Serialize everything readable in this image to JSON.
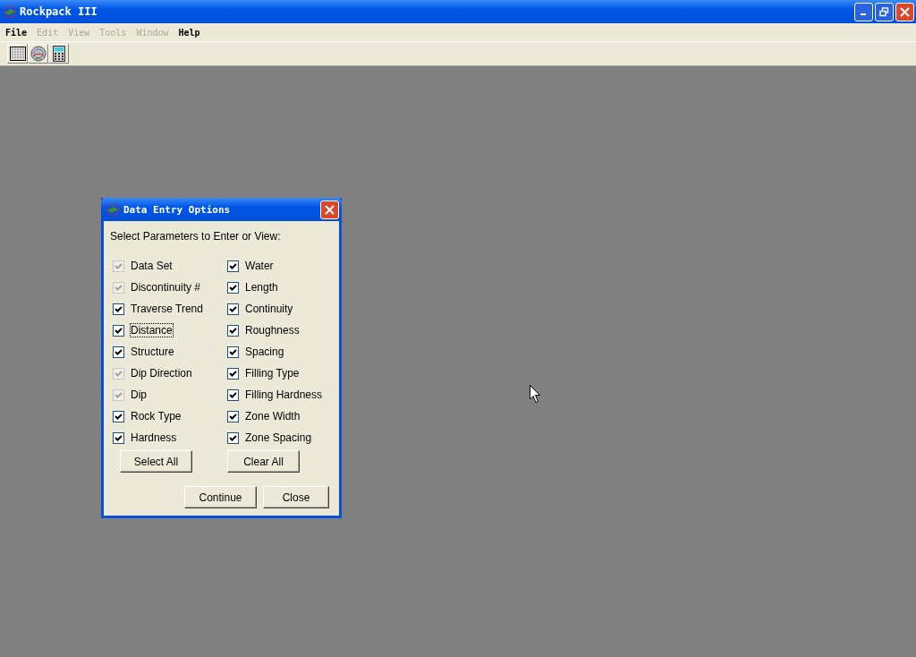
{
  "window": {
    "title": "Rockpack III"
  },
  "menu": [
    {
      "label": "File",
      "disabled": false
    },
    {
      "label": "Edit",
      "disabled": true
    },
    {
      "label": "View",
      "disabled": true
    },
    {
      "label": "Tools",
      "disabled": true
    },
    {
      "label": "Window",
      "disabled": true
    },
    {
      "label": "Help",
      "disabled": false
    }
  ],
  "toolbar": [
    {
      "kind": "grid"
    },
    {
      "kind": "stereonet"
    },
    {
      "kind": "calculator"
    }
  ],
  "dialog": {
    "title": "Data Entry Options",
    "prompt": "Select Parameters to Enter or View:",
    "parameters": [
      {
        "label": "Data Set",
        "checked": true,
        "disabled": true,
        "focused": false
      },
      {
        "label": "Discontinuity #",
        "checked": true,
        "disabled": true,
        "focused": false
      },
      {
        "label": "Traverse Trend",
        "checked": true,
        "disabled": false,
        "focused": false
      },
      {
        "label": "Distance",
        "checked": true,
        "disabled": false,
        "focused": true
      },
      {
        "label": "Structure",
        "checked": true,
        "disabled": false,
        "focused": false
      },
      {
        "label": "Dip Direction",
        "checked": true,
        "disabled": true,
        "focused": false
      },
      {
        "label": "Dip",
        "checked": true,
        "disabled": true,
        "focused": false
      },
      {
        "label": "Rock Type",
        "checked": true,
        "disabled": false,
        "focused": false
      },
      {
        "label": "Hardness",
        "checked": true,
        "disabled": false,
        "focused": false
      },
      {
        "label": "Water",
        "checked": true,
        "disabled": false,
        "focused": false
      },
      {
        "label": "Length",
        "checked": true,
        "disabled": false,
        "focused": false
      },
      {
        "label": "Continuity",
        "checked": true,
        "disabled": false,
        "focused": false
      },
      {
        "label": "Roughness",
        "checked": true,
        "disabled": false,
        "focused": false
      },
      {
        "label": "Spacing",
        "checked": true,
        "disabled": false,
        "focused": false
      },
      {
        "label": "Filling Type",
        "checked": true,
        "disabled": false,
        "focused": false
      },
      {
        "label": "Filling Hardness",
        "checked": true,
        "disabled": false,
        "focused": false
      },
      {
        "label": "Zone Width",
        "checked": true,
        "disabled": false,
        "focused": false
      },
      {
        "label": "Zone Spacing",
        "checked": true,
        "disabled": false,
        "focused": false
      }
    ],
    "select_buttons": [
      "Select All",
      "Clear All"
    ],
    "action_buttons": [
      "Continue",
      "Close"
    ]
  }
}
